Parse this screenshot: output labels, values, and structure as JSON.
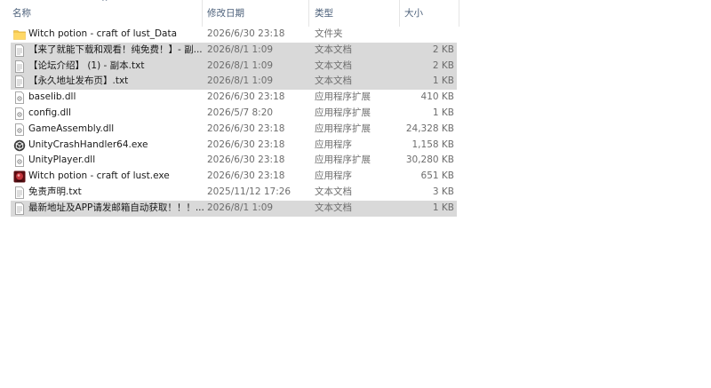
{
  "header": {
    "name_label": "名称",
    "date_label": "修改日期",
    "type_label": "类型",
    "size_label": "大小",
    "sort_arrow": "^"
  },
  "files": [
    {
      "icon": "folder-icon",
      "name": "Witch potion - craft of lust_Data",
      "date": "2026/6/30 23:18",
      "type": "文件夹",
      "size": "",
      "selected": false
    },
    {
      "icon": "text-file-icon",
      "name": "【来了就能下载和观看！纯免费！】- 副...",
      "date": "2026/8/1 1:09",
      "type": "文本文档",
      "size": "2 KB",
      "selected": true
    },
    {
      "icon": "text-file-icon",
      "name": "【论坛介绍】 (1) - 副本.txt",
      "date": "2026/8/1 1:09",
      "type": "文本文档",
      "size": "2 KB",
      "selected": true
    },
    {
      "icon": "text-file-icon",
      "name": "【永久地址发布页】.txt",
      "date": "2026/8/1 1:09",
      "type": "文本文档",
      "size": "1 KB",
      "selected": true
    },
    {
      "icon": "dll-file-icon",
      "name": "baselib.dll",
      "date": "2026/6/30 23:18",
      "type": "应用程序扩展",
      "size": "410 KB",
      "selected": false
    },
    {
      "icon": "dll-file-icon",
      "name": "config.dll",
      "date": "2026/5/7 8:20",
      "type": "应用程序扩展",
      "size": "1 KB",
      "selected": false
    },
    {
      "icon": "dll-file-icon",
      "name": "GameAssembly.dll",
      "date": "2026/6/30 23:18",
      "type": "应用程序扩展",
      "size": "24,328 KB",
      "selected": false
    },
    {
      "icon": "unity-exe-icon",
      "name": "UnityCrashHandler64.exe",
      "date": "2026/6/30 23:18",
      "type": "应用程序",
      "size": "1,158 KB",
      "selected": false
    },
    {
      "icon": "dll-file-icon",
      "name": "UnityPlayer.dll",
      "date": "2026/6/30 23:18",
      "type": "应用程序扩展",
      "size": "30,280 KB",
      "selected": false
    },
    {
      "icon": "game-exe-icon",
      "name": "Witch potion - craft of lust.exe",
      "date": "2026/6/30 23:18",
      "type": "应用程序",
      "size": "651 KB",
      "selected": false
    },
    {
      "icon": "text-file-icon",
      "name": "免责声明.txt",
      "date": "2025/11/12 17:26",
      "type": "文本文档",
      "size": "3 KB",
      "selected": false
    },
    {
      "icon": "text-file-icon",
      "name": "最新地址及APP请发邮箱自动获取！！！...",
      "date": "2026/8/1 1:09",
      "type": "文本文档",
      "size": "1 KB",
      "selected": true
    }
  ]
}
